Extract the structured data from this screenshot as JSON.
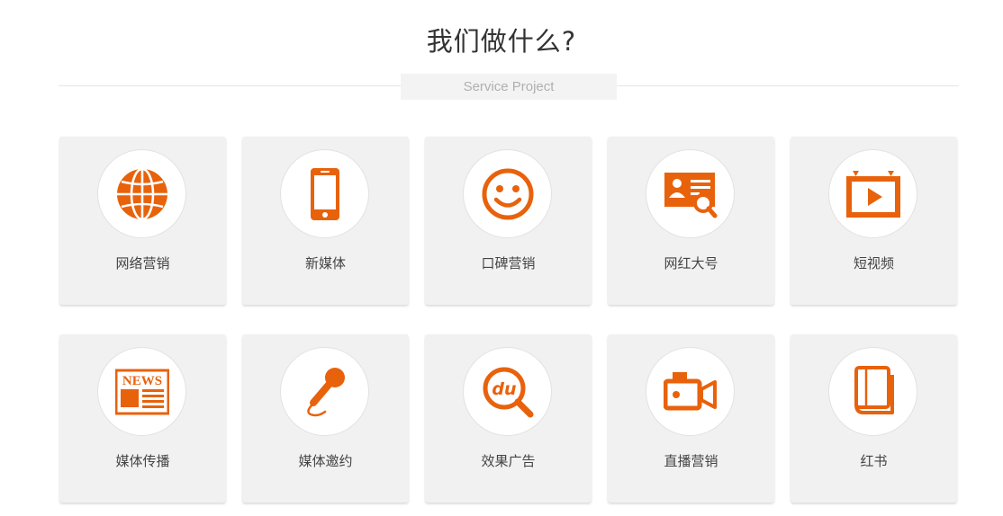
{
  "header": {
    "title": "我们做什么?",
    "subtitle": "Service Project"
  },
  "services": [
    {
      "label": "网络营销",
      "icon": "globe-icon"
    },
    {
      "label": "新媒体",
      "icon": "smartphone-icon"
    },
    {
      "label": "口碑营销",
      "icon": "smiley-icon"
    },
    {
      "label": "网红大号",
      "icon": "id-card-search-icon"
    },
    {
      "label": "短视频",
      "icon": "video-play-icon"
    },
    {
      "label": "媒体传播",
      "icon": "newspaper-icon",
      "icon_text": "NEWS"
    },
    {
      "label": "媒体邀约",
      "icon": "microphone-icon"
    },
    {
      "label": "效果广告",
      "icon": "baidu-search-icon",
      "icon_text": "du"
    },
    {
      "label": "直播营销",
      "icon": "video-camera-icon"
    },
    {
      "label": "红书",
      "icon": "book-icon"
    }
  ],
  "colors": {
    "accent": "#e8620c",
    "card_bg": "#f1f1f1",
    "title": "#333333",
    "subtitle": "#b0b0b0"
  }
}
